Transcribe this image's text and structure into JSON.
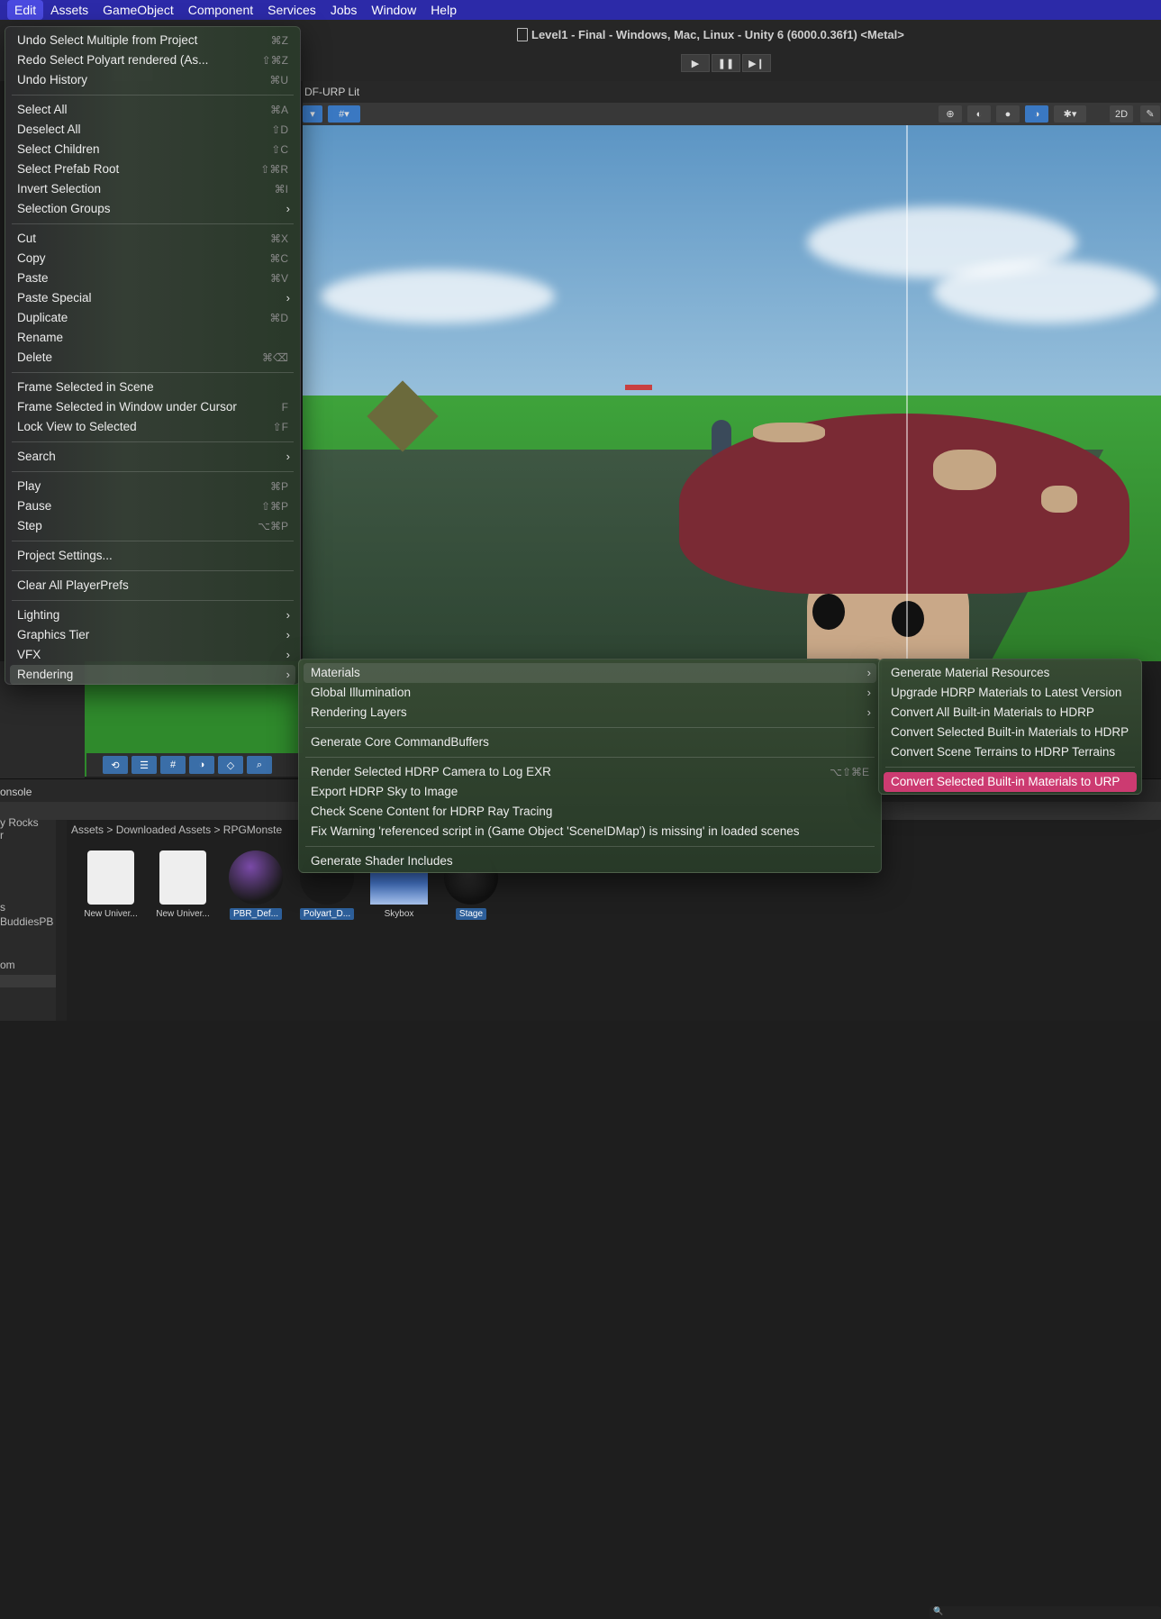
{
  "menubar": {
    "items": [
      "Edit",
      "Assets",
      "GameObject",
      "Component",
      "Services",
      "Jobs",
      "Window",
      "Help"
    ],
    "active": "Edit"
  },
  "window": {
    "title": "Level1 - Final - Windows, Mac, Linux - Unity 6 (6000.0.36f1) <Metal>",
    "scene_tab_label": "DF-URP Lit",
    "play_icon": "play-icon",
    "pause_icon": "pause-icon",
    "step_icon": "step-icon"
  },
  "edit_menu": {
    "groups": [
      [
        {
          "label": "Undo Select Multiple from Project",
          "shortcut": "⌘Z"
        },
        {
          "label": "Redo Select Polyart rendered (As...",
          "shortcut": "⇧⌘Z"
        },
        {
          "label": "Undo History",
          "shortcut": "⌘U"
        }
      ],
      [
        {
          "label": "Select All",
          "shortcut": "⌘A"
        },
        {
          "label": "Deselect All",
          "shortcut": "⇧D"
        },
        {
          "label": "Select Children",
          "shortcut": "⇧C"
        },
        {
          "label": "Select Prefab Root",
          "shortcut": "⇧⌘R"
        },
        {
          "label": "Invert Selection",
          "shortcut": "⌘I"
        },
        {
          "label": "Selection Groups",
          "submenu": true
        }
      ],
      [
        {
          "label": "Cut",
          "shortcut": "⌘X"
        },
        {
          "label": "Copy",
          "shortcut": "⌘C"
        },
        {
          "label": "Paste",
          "shortcut": "⌘V"
        },
        {
          "label": "Paste Special",
          "submenu": true
        },
        {
          "label": "Duplicate",
          "shortcut": "⌘D"
        },
        {
          "label": "Rename",
          "shortcut": ""
        },
        {
          "label": "Delete",
          "shortcut": "⌘⌫"
        }
      ],
      [
        {
          "label": "Frame Selected in Scene",
          "shortcut": ""
        },
        {
          "label": "Frame Selected in Window under Cursor",
          "shortcut": "F"
        },
        {
          "label": "Lock View to Selected",
          "shortcut": "⇧F"
        }
      ],
      [
        {
          "label": "Search",
          "submenu": true
        }
      ],
      [
        {
          "label": "Play",
          "shortcut": "⌘P"
        },
        {
          "label": "Pause",
          "shortcut": "⇧⌘P"
        },
        {
          "label": "Step",
          "shortcut": "⌥⌘P"
        }
      ],
      [
        {
          "label": "Project Settings...",
          "shortcut": ""
        }
      ],
      [
        {
          "label": "Clear All PlayerPrefs",
          "shortcut": ""
        }
      ],
      [
        {
          "label": "Lighting",
          "submenu": true
        },
        {
          "label": "Graphics Tier",
          "submenu": true
        },
        {
          "label": "VFX",
          "submenu": true
        },
        {
          "label": "Rendering",
          "submenu": true,
          "highlighted": true
        }
      ]
    ]
  },
  "rendering_menu": {
    "groups": [
      [
        {
          "label": "Materials",
          "submenu": true,
          "highlighted": true
        },
        {
          "label": "Global Illumination",
          "submenu": true
        },
        {
          "label": "Rendering Layers",
          "submenu": true
        }
      ],
      [
        {
          "label": "Generate Core CommandBuffers",
          "shortcut": ""
        }
      ],
      [
        {
          "label": "Render Selected HDRP Camera to Log EXR",
          "shortcut": "⌥⇧⌘E"
        },
        {
          "label": "Export HDRP Sky to Image",
          "shortcut": ""
        },
        {
          "label": "Check Scene Content for HDRP Ray Tracing",
          "shortcut": ""
        },
        {
          "label": "Fix Warning 'referenced script in (Game Object 'SceneIDMap') is missing' in loaded scenes",
          "shortcut": ""
        }
      ],
      [
        {
          "label": "Generate Shader Includes",
          "shortcut": ""
        }
      ]
    ]
  },
  "materials_menu": {
    "groups": [
      [
        {
          "label": "Generate Material Resources"
        },
        {
          "label": "Upgrade HDRP Materials to Latest Version"
        },
        {
          "label": "Convert All Built-in Materials to HDRP"
        },
        {
          "label": "Convert Selected Built-in Materials to HDRP"
        },
        {
          "label": "Convert Scene Terrains to HDRP Terrains"
        }
      ],
      [
        {
          "label": "Convert Selected Built-in Materials to URP",
          "highlighted": true
        }
      ]
    ]
  },
  "console": {
    "tab_label": "onsole"
  },
  "project": {
    "left_items": [
      "y Rocks",
      "r",
      "s",
      "BuddiesPB",
      "om"
    ],
    "breadcrumb": [
      "Assets",
      "Downloaded Assets",
      "RPGMonste"
    ],
    "assets": [
      {
        "name": "New Univer...",
        "kind": "doc",
        "selected": false
      },
      {
        "name": "New Univer...",
        "kind": "doc",
        "selected": false
      },
      {
        "name": "PBR_Def...",
        "kind": "sphere-pbr",
        "selected": true
      },
      {
        "name": "Polyart_D...",
        "kind": "sphere",
        "selected": true
      },
      {
        "name": "Skybox",
        "kind": "sky",
        "selected": false
      },
      {
        "name": "Stage",
        "kind": "sphere",
        "selected": true
      }
    ]
  },
  "colors": {
    "menubar": "#2c2aa8",
    "highlight_pink": "#cc3b71",
    "selection_blue": "#2d5f9a"
  }
}
